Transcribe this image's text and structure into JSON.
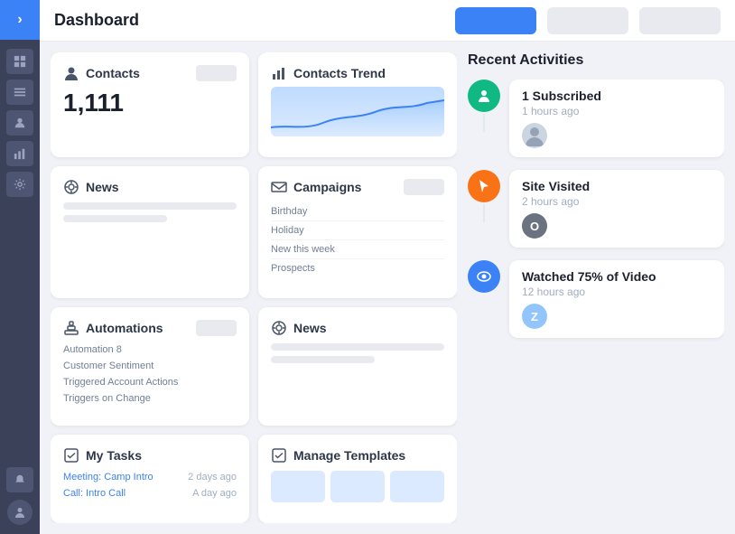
{
  "header": {
    "title": "Dashboard",
    "btn_primary": "––––––––",
    "btn_secondary1": "––––––––",
    "btn_secondary2": "––––––––"
  },
  "sidebar": {
    "logo": "›",
    "items": [
      {
        "name": "grid-icon"
      },
      {
        "name": "list-icon"
      },
      {
        "name": "users-icon"
      },
      {
        "name": "chart-icon"
      },
      {
        "name": "settings-icon"
      }
    ]
  },
  "cards": {
    "contacts": {
      "title": "Contacts",
      "value": "1,111"
    },
    "contacts_trend": {
      "title": "Contacts Trend"
    },
    "news_top": {
      "title": "News"
    },
    "campaigns": {
      "title": "Campaigns",
      "items": [
        "Birthday",
        "Holiday",
        "New this week",
        "Prospects"
      ]
    },
    "automations": {
      "title": "Automations",
      "items": [
        "Automation 8",
        "Customer Sentiment",
        "Triggered Account Actions",
        "Triggers on Change"
      ]
    },
    "news_bottom": {
      "title": "News"
    },
    "my_tasks": {
      "title": "My Tasks",
      "items": [
        {
          "name": "Meeting: Camp Intro",
          "date": "2 days ago"
        },
        {
          "name": "Call: Intro Call",
          "date": "A day ago"
        }
      ]
    },
    "manage_templates": {
      "title": "Manage Templates"
    }
  },
  "activities": {
    "title": "Recent Activities",
    "items": [
      {
        "icon_type": "person",
        "icon_color": "green",
        "title": "1 Subscribed",
        "time": "1 hours ago",
        "user_type": "avatar"
      },
      {
        "icon_type": "cursor",
        "icon_color": "orange",
        "title": "Site Visited",
        "time": "2 hours ago",
        "user_type": "letter",
        "user_letter": "O",
        "user_color": "#6b7280"
      },
      {
        "icon_type": "eye",
        "icon_color": "blue",
        "title": "Watched 75% of Video",
        "time": "12 hours ago",
        "user_type": "letter",
        "user_letter": "Z",
        "user_color": "#93c5fd"
      }
    ]
  }
}
